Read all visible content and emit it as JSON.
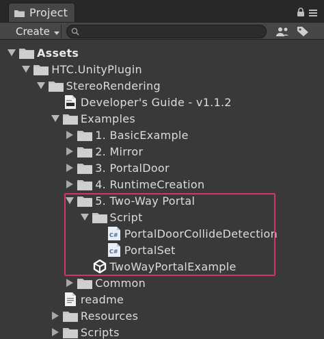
{
  "window": {
    "tab_label": "Project"
  },
  "toolbar": {
    "create_label": "Create",
    "search_placeholder": ""
  },
  "tree": [
    {
      "label": "Assets",
      "depth": 0,
      "expanded": true,
      "kind": "folder",
      "bold": true
    },
    {
      "label": "HTC.UnityPlugin",
      "depth": 1,
      "expanded": true,
      "kind": "folder"
    },
    {
      "label": "StereoRendering",
      "depth": 2,
      "expanded": true,
      "kind": "folder"
    },
    {
      "label": "Developer's Guide - v1.1.2",
      "depth": 3,
      "kind": "pdf"
    },
    {
      "label": "Examples",
      "depth": 3,
      "expanded": true,
      "kind": "folder"
    },
    {
      "label": "1. BasicExample",
      "depth": 4,
      "expanded": false,
      "kind": "folder"
    },
    {
      "label": "2. Mirror",
      "depth": 4,
      "expanded": false,
      "kind": "folder"
    },
    {
      "label": "3. PortalDoor",
      "depth": 4,
      "expanded": false,
      "kind": "folder"
    },
    {
      "label": "4. RuntimeCreation",
      "depth": 4,
      "expanded": false,
      "kind": "folder"
    },
    {
      "label": "5. Two-Way Portal",
      "depth": 4,
      "expanded": true,
      "kind": "folder"
    },
    {
      "label": "Script",
      "depth": 5,
      "expanded": true,
      "kind": "folder"
    },
    {
      "label": "PortalDoorCollideDetection",
      "depth": 6,
      "kind": "csharp"
    },
    {
      "label": "PortalSet",
      "depth": 6,
      "kind": "csharp"
    },
    {
      "label": "TwoWayPortalExample",
      "depth": 5,
      "kind": "unity"
    },
    {
      "label": "Common",
      "depth": 4,
      "expanded": false,
      "kind": "folder"
    },
    {
      "label": "readme",
      "depth": 3,
      "kind": "text"
    },
    {
      "label": "Resources",
      "depth": 3,
      "expanded": false,
      "kind": "folder"
    },
    {
      "label": "Scripts",
      "depth": 3,
      "expanded": false,
      "kind": "folder"
    }
  ],
  "colors": {
    "highlight": "#d6336c",
    "panel_bg": "#393939"
  }
}
